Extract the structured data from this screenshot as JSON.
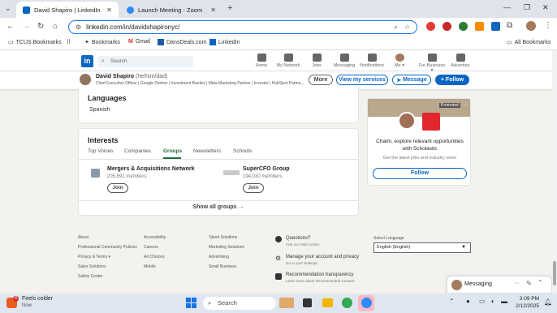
{
  "tabs": [
    {
      "title": "David Shapiro | LinkedIn",
      "color": "#0a66c2"
    },
    {
      "title": "Launch Meeting - Zoom",
      "color": "#2d8cff"
    }
  ],
  "url": "linkedin.com/in/davidshapironyc/",
  "bookmarks": [
    "TCUS Bookmarks",
    "Bookmarks",
    "Gmail",
    "DansDeals.com",
    "LinkedIn",
    "All Bookmarks"
  ],
  "header": {
    "search_placeholder": "Search",
    "nav": [
      "Home",
      "My Network",
      "Jobs",
      "Messaging",
      "Notifications",
      "Me ▾",
      "For Business ▾",
      "Advertise"
    ]
  },
  "profile_bar": {
    "name": "David Shapiro",
    "pronouns": "(he/him/dad)",
    "headline": "Chief Executive Officer | Google Partner | Investment Banker | Meta Marketing Partner | Investor | HubSpot Partne...",
    "more": "More",
    "services": "View my services",
    "message": "Message",
    "follow": "+ Follow"
  },
  "languages": {
    "title": "Languages",
    "items": [
      "Spanish"
    ]
  },
  "interests": {
    "title": "Interests",
    "tabs": [
      "Top Voices",
      "Companies",
      "Groups",
      "Newsletters",
      "Schools"
    ],
    "active_tab": "Groups",
    "groups": [
      {
        "name": "Mergers & Acquisitions Network",
        "members": "205,691 members",
        "join": "Join"
      },
      {
        "name": "SuperCFO Group",
        "members": "194,030 members",
        "join": "Join"
      }
    ],
    "show_all": "Show all groups →"
  },
  "ad": {
    "promoted": "Promoted",
    "headline": "Chaim, explore relevant opportunities with Scholastic",
    "sub": "Get the latest jobs and industry news",
    "follow": "Follow"
  },
  "footer": {
    "col1": [
      "About",
      "Professional Community Policies",
      "Privacy & Terms ▾",
      "Sales Solutions",
      "Safety Center"
    ],
    "col2": [
      "Accessibility",
      "Careers",
      "Ad Choices",
      "Mobile"
    ],
    "col3": [
      "Talent Solutions",
      "Marketing Solutions",
      "Advertising",
      "Small Business"
    ],
    "help": [
      {
        "title": "Questions?",
        "sub": "Visit our Help Center."
      },
      {
        "title": "Manage your account and privacy",
        "sub": "Go to your Settings."
      },
      {
        "title": "Recommendation transparency",
        "sub": "Learn more about Recommended Content."
      }
    ],
    "language_label": "Select Language",
    "language_value": "English (English)"
  },
  "messaging": {
    "label": "Messaging"
  },
  "taskbar": {
    "weather_temp": "Feels colder",
    "weather_sub": "Now",
    "weather_badge": "4",
    "search": "Search",
    "time": "3:09 PM",
    "date": "2/12/2025"
  }
}
